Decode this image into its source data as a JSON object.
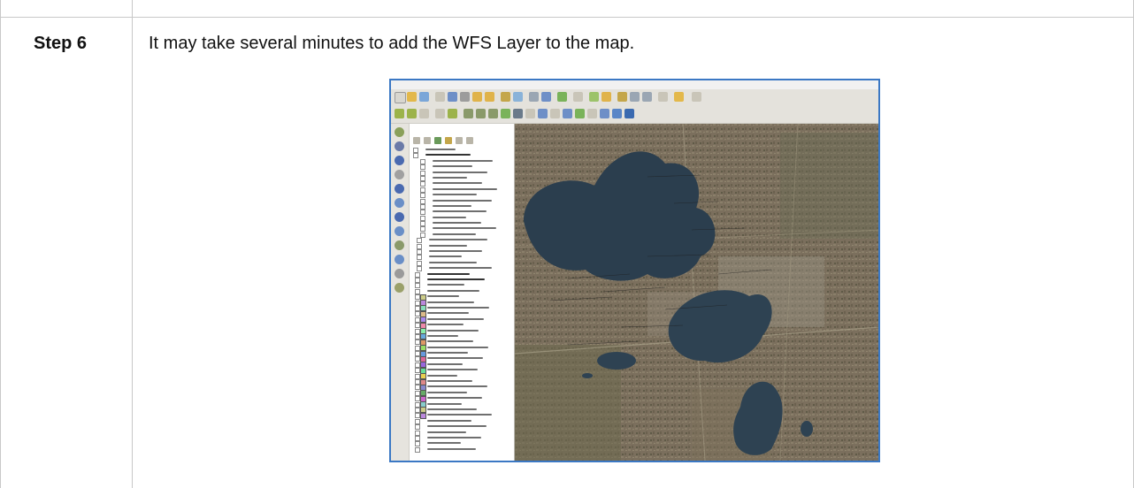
{
  "step": {
    "label": "Step 6",
    "description": "It may take several minutes to add the WFS Layer to the map."
  },
  "screenshot": {
    "colors": {
      "border": "#3b78c4",
      "water": "#2b3e4e",
      "land": "#7a6e5c"
    }
  }
}
